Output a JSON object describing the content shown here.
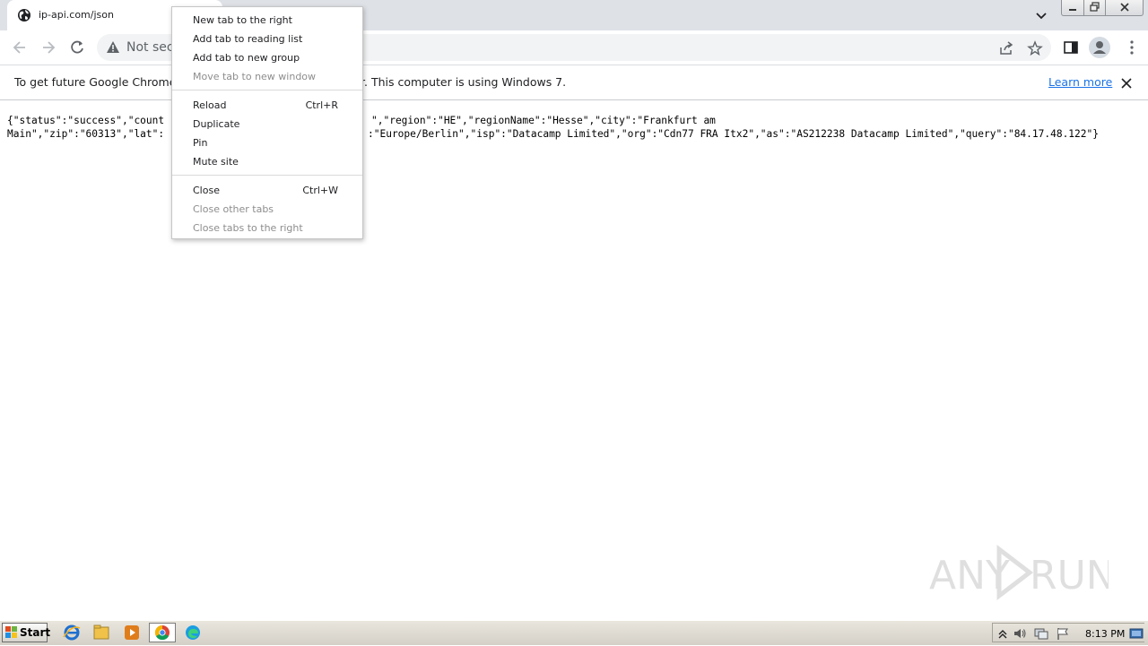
{
  "tab": {
    "title": "ip-api.com/json",
    "favicon": "globe-icon"
  },
  "omnibox": {
    "security_label": "Not secu",
    "icon": "warning-triangle-icon"
  },
  "infobar": {
    "text_left": "To get future Google Chrome up",
    "text_right": "r. This computer is using Windows 7.",
    "link": "Learn more"
  },
  "content": {
    "line1_left": "{\"status\":\"success\",\"count",
    "line1_right": "\",\"region\":\"HE\",\"regionName\":\"Hesse\",\"city\":\"Frankfurt am",
    "line2_left": "Main\",\"zip\":\"60313\",\"lat\":",
    "line2_right": ":\"Europe/Berlin\",\"isp\":\"Datacamp Limited\",\"org\":\"Cdn77 FRA Itx2\",\"as\":\"AS212238 Datacamp Limited\",\"query\":\"84.17.48.122\"}"
  },
  "context_menu": {
    "group1": [
      {
        "label": "New tab to the right",
        "shortcut": "",
        "disabled": false
      },
      {
        "label": "Add tab to reading list",
        "shortcut": "",
        "disabled": false
      },
      {
        "label": "Add tab to new group",
        "shortcut": "",
        "disabled": false
      },
      {
        "label": "Move tab to new window",
        "shortcut": "",
        "disabled": true
      }
    ],
    "group2": [
      {
        "label": "Reload",
        "shortcut": "Ctrl+R",
        "disabled": false
      },
      {
        "label": "Duplicate",
        "shortcut": "",
        "disabled": false
      },
      {
        "label": "Pin",
        "shortcut": "",
        "disabled": false
      },
      {
        "label": "Mute site",
        "shortcut": "",
        "disabled": false
      }
    ],
    "group3": [
      {
        "label": "Close",
        "shortcut": "Ctrl+W",
        "disabled": false
      },
      {
        "label": "Close other tabs",
        "shortcut": "",
        "disabled": true
      },
      {
        "label": "Close tabs to the right",
        "shortcut": "",
        "disabled": true
      }
    ]
  },
  "watermark": {
    "text": "ANY RUN"
  },
  "taskbar": {
    "start_label": "Start",
    "apps": [
      "internet-explorer-icon",
      "file-explorer-icon",
      "media-player-icon",
      "chrome-icon",
      "edge-icon"
    ],
    "clock": "8:13 PM"
  },
  "colors": {
    "tabstrip": "#dee1e6",
    "link": "#1a73e8",
    "disabled_text": "#8d8d8d"
  }
}
